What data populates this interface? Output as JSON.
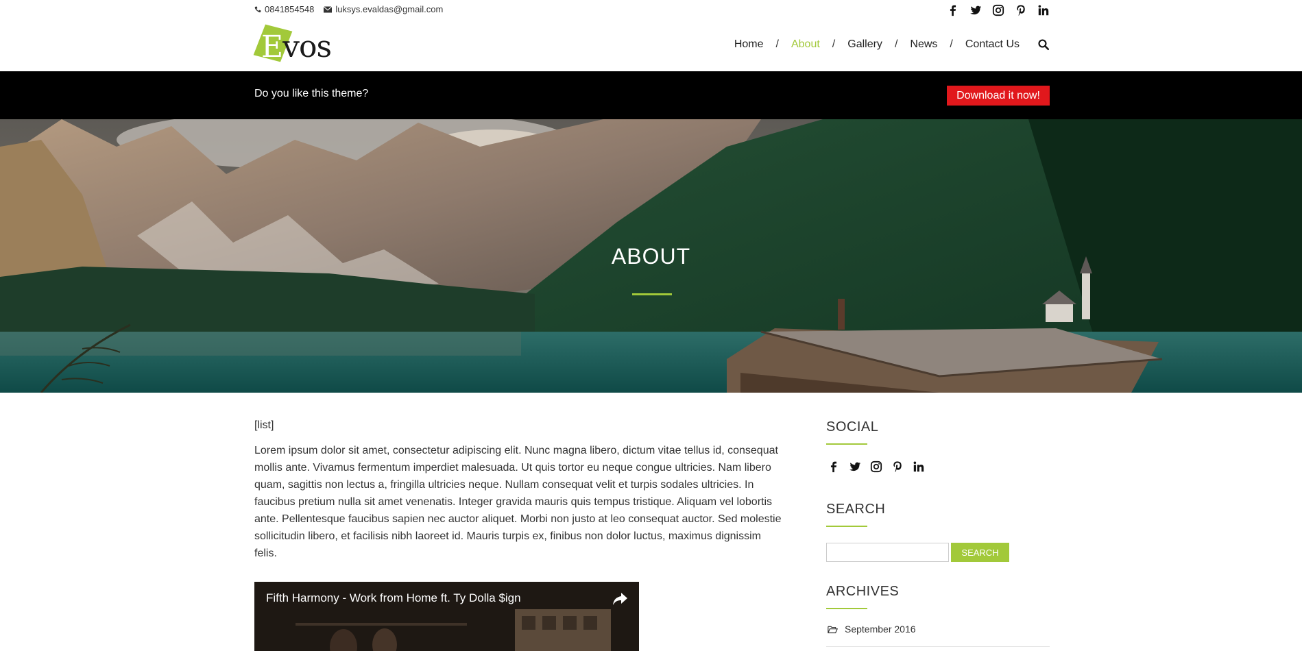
{
  "topbar": {
    "phone": "0841854548",
    "email": "luksys.evaldas@gmail.com",
    "social_icons": [
      "facebook-icon",
      "twitter-icon",
      "instagram-icon",
      "pinterest-icon",
      "linkedin-icon"
    ]
  },
  "logo": {
    "first_letter": "E",
    "rest": "vos"
  },
  "nav": {
    "items": [
      "Home",
      "About",
      "Gallery",
      "News",
      "Contact Us"
    ],
    "separator": "/",
    "active": "About"
  },
  "promo": {
    "message": "Do you like this theme?",
    "button": "Download it now!"
  },
  "hero": {
    "title": "ABOUT"
  },
  "content": {
    "shortcode": "[list]",
    "paragraph": "Lorem ipsum dolor sit amet, consectetur adipiscing elit. Nunc magna libero, dictum vitae tellus id, consequat mollis ante. Vivamus fermentum imperdiet malesuada. Ut quis tortor eu neque congue ultricies. Nam libero quam, sagittis non lectus a, fringilla ultricies neque. Nullam consequat velit et turpis sodales ultricies. In faucibus pretium nulla sit amet venenatis. Integer gravida mauris quis tempus tristique. Aliquam vel lobortis ante. Pellentesque faucibus sapien nec auctor aliquet. Morbi non justo at leo consequat auctor. Sed molestie sollicitudin libero, et facilisis nibh laoreet id. Mauris turpis ex, finibus non dolor luctus, maximus dignissim felis.",
    "video_title": "Fifth Harmony - Work from Home ft. Ty Dolla $ign"
  },
  "sidebar": {
    "social_title": "SOCIAL",
    "search_title": "SEARCH",
    "search_button": "SEARCH",
    "search_value": "",
    "archives_title": "ARCHIVES",
    "archives": [
      "September 2016"
    ]
  },
  "colors": {
    "accent": "#a2c93a",
    "promo_bg": "#000000",
    "download_button": "#e1181c"
  }
}
